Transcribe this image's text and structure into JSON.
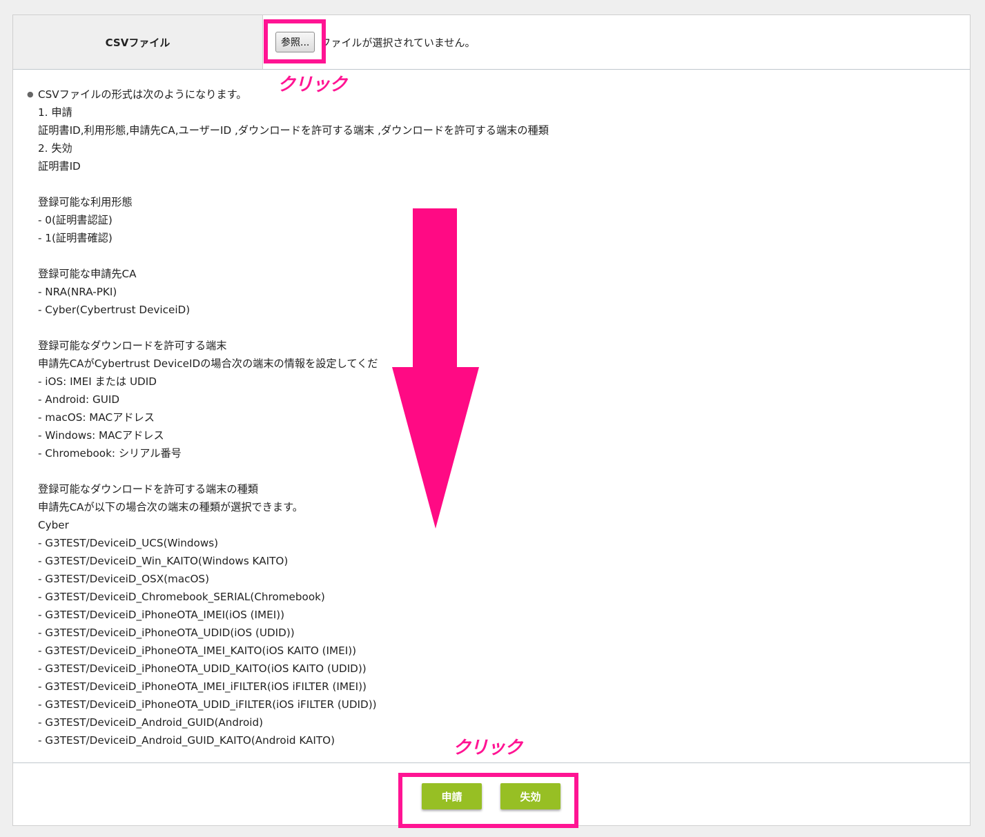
{
  "form": {
    "file_label": "CSVファイル",
    "browse_label": "参照...",
    "no_file_text": "ファイルが選択されていません。"
  },
  "info": {
    "heading": "CSVファイルの形式は次のようになります。",
    "lines": [
      "1. 申請",
      "証明書ID,利用形態,申請先CA,ユーザーID ,ダウンロードを許可する端末 ,ダウンロードを許可する端末の種類",
      "2. 失効",
      "証明書ID",
      "",
      "登録可能な利用形態",
      "- 0(証明書認証)",
      "- 1(証明書確認)",
      "",
      "登録可能な申請先CA",
      "- NRA(NRA-PKI)",
      "- Cyber(Cybertrust DeviceiD)",
      "",
      "登録可能なダウンロードを許可する端末",
      "申請先CAがCybertrust DeviceIDの場合次の端末の情報を設定してくだ",
      "- iOS: IMEI または UDID",
      "- Android: GUID",
      "- macOS: MACアドレス",
      "- Windows: MACアドレス",
      "- Chromebook: シリアル番号",
      "",
      "登録可能なダウンロードを許可する端末の種類",
      "申請先CAが以下の場合次の端末の種類が選択できます。",
      "Cyber",
      "- G3TEST/DeviceiD_UCS(Windows)",
      "- G3TEST/DeviceiD_Win_KAITO(Windows KAITO)",
      "- G3TEST/DeviceiD_OSX(macOS)",
      "- G3TEST/DeviceiD_Chromebook_SERIAL(Chromebook)",
      "- G3TEST/DeviceiD_iPhoneOTA_IMEI(iOS (IMEI))",
      "- G3TEST/DeviceiD_iPhoneOTA_UDID(iOS (UDID))",
      "- G3TEST/DeviceiD_iPhoneOTA_IMEI_KAITO(iOS KAITO (IMEI))",
      "- G3TEST/DeviceiD_iPhoneOTA_UDID_KAITO(iOS KAITO (UDID))",
      "- G3TEST/DeviceiD_iPhoneOTA_IMEI_iFILTER(iOS iFILTER (IMEI))",
      "- G3TEST/DeviceiD_iPhoneOTA_UDID_iFILTER(iOS iFILTER (UDID))",
      "- G3TEST/DeviceiD_Android_GUID(Android)",
      "- G3TEST/DeviceiD_Android_GUID_KAITO(Android KAITO)"
    ]
  },
  "actions": {
    "apply_label": "申請",
    "revoke_label": "失効"
  },
  "annotations": {
    "click_label_top": "クリック",
    "click_label_bottom": "クリック",
    "highlight_color": "#ff1493",
    "button_color": "#97bf24"
  }
}
